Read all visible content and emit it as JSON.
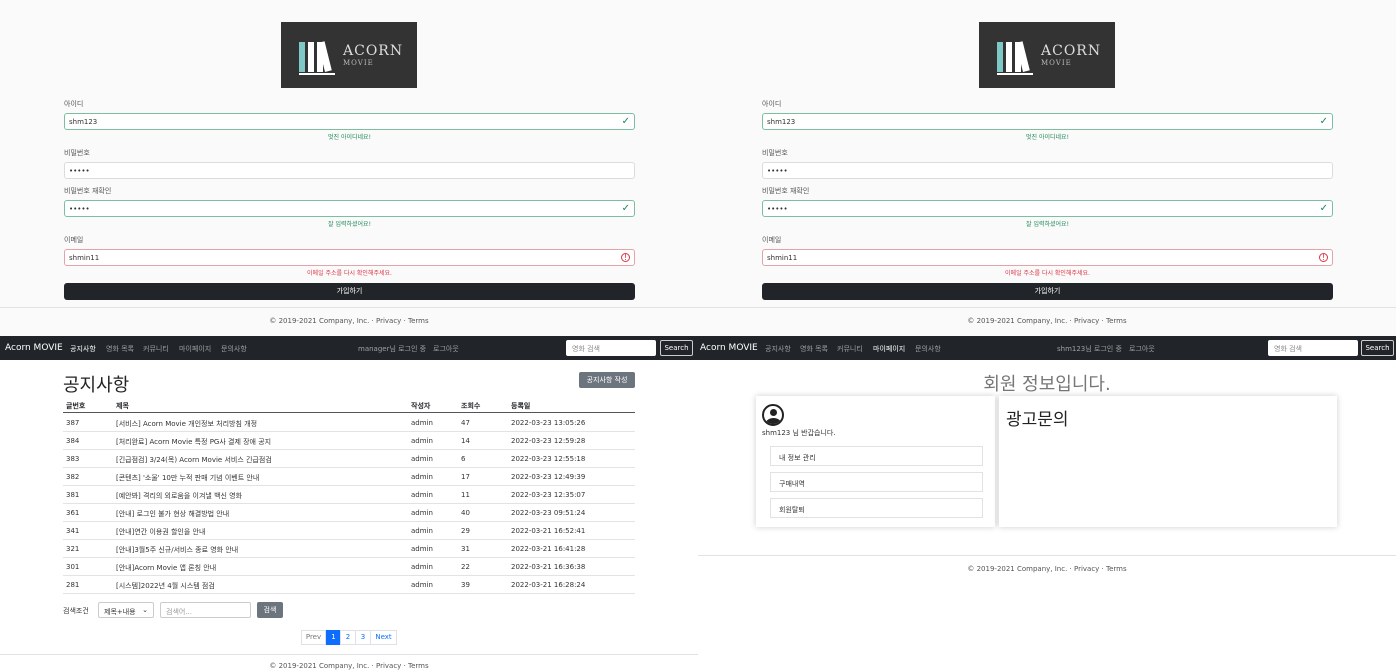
{
  "signup": {
    "logo_title": "ACORN",
    "logo_sub": "MOVIE",
    "id_label": "아이디",
    "id_value": "shm123",
    "id_feedback": "멋진 아이디네요!",
    "pw_label": "비밀번호",
    "pw_value": "•••••",
    "pw2_label": "비밀번호 재확인",
    "pw2_value": "•••••",
    "pw2_feedback": "잘 입력하셨어요!",
    "email_label": "이메일",
    "email_value": "shmin11",
    "email_feedback": "이메일 주소를 다시 확인해주세요.",
    "submit_label": "가입하기",
    "valid_icon": "check-icon",
    "invalid_icon": "alert-icon"
  },
  "footer": {
    "copyright": "© 2019-2021 Company, Inc. · Privacy · Terms"
  },
  "navbar": {
    "brand": "Acorn MOVIE",
    "items": [
      "공지사항",
      "영화 목록",
      "커뮤니티",
      "마이페이지",
      "문의사항"
    ],
    "search_placeholder": "영화 검색",
    "search_button": "Search",
    "notice_user": {
      "greeting": "manager님 로그인 중",
      "logout": "로그아웃"
    },
    "mypage_user": {
      "greeting": "shm123님 로그인 중",
      "logout": "로그아웃"
    }
  },
  "notice": {
    "title": "공지사항",
    "write_button": "공지사항 작성",
    "columns": [
      "글번호",
      "제목",
      "작성자",
      "조회수",
      "등록일"
    ],
    "rows": [
      {
        "no": "387",
        "title": "[서비스] Acorn Movie 개인정보 처리방침 개정",
        "author": "admin",
        "views": "47",
        "date": "2022-03-23 13:05:26"
      },
      {
        "no": "384",
        "title": "[처리완료] Acorn Movie 특정 PG사 결제 장애 공지",
        "author": "admin",
        "views": "14",
        "date": "2022-03-23 12:59:28"
      },
      {
        "no": "383",
        "title": "[긴급점검] 3/24(목) Acorn Movie 서비스 긴급점검",
        "author": "admin",
        "views": "6",
        "date": "2022-03-23 12:55:18"
      },
      {
        "no": "382",
        "title": "[콘텐츠] '소울' 10만 누적 판매 기념 이벤트 안내",
        "author": "admin",
        "views": "17",
        "date": "2022-03-23 12:49:39"
      },
      {
        "no": "381",
        "title": "[예안봐] 격리의 외로움을 이겨낼 백신 영화",
        "author": "admin",
        "views": "11",
        "date": "2022-03-23 12:35:07"
      },
      {
        "no": "361",
        "title": "[안내] 로그인 불가 현상 해결방법 안내",
        "author": "admin",
        "views": "40",
        "date": "2022-03-23 09:51:24"
      },
      {
        "no": "341",
        "title": "[안내]연간 이용권 할인을 안내",
        "author": "admin",
        "views": "29",
        "date": "2022-03-21 16:52:41"
      },
      {
        "no": "321",
        "title": "[안내]3월5주 신규/서비스 종료 영화 안내",
        "author": "admin",
        "views": "31",
        "date": "2022-03-21 16:41:28"
      },
      {
        "no": "301",
        "title": "[안내]Acorn Movie 앱 론칭 안내",
        "author": "admin",
        "views": "22",
        "date": "2022-03-21 16:36:38"
      },
      {
        "no": "281",
        "title": "[시스템]2022년 4월 시스템 점검",
        "author": "admin",
        "views": "39",
        "date": "2022-03-21 16:28:24"
      }
    ],
    "search_label": "검색조건",
    "search_select": "제목+내용",
    "search_placeholder": "검색어...",
    "search_button": "검색",
    "pagination": [
      "Prev",
      "1",
      "2",
      "3",
      "Next"
    ],
    "current_page": "1"
  },
  "mypage": {
    "title": "회원 정보입니다.",
    "greeting": "shm123 님 반갑습니다.",
    "menu": [
      "내 정보 관리",
      "구매내역",
      "회원탈퇴"
    ],
    "panel_title": "광고문의"
  }
}
